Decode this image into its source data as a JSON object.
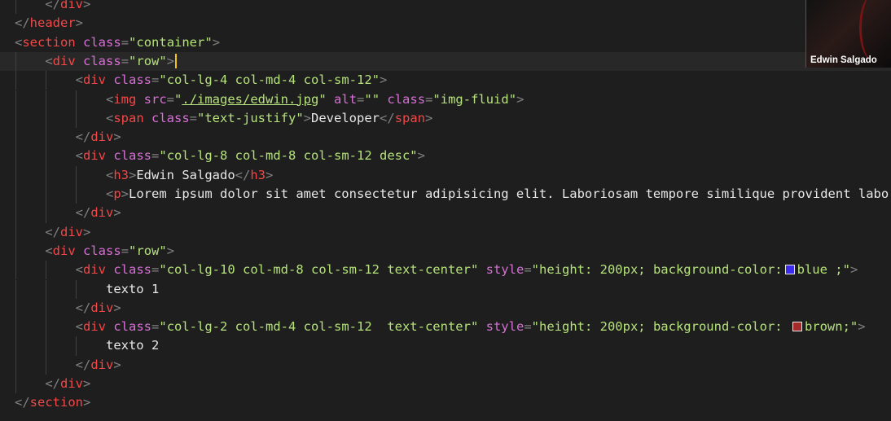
{
  "editor": {
    "lines": [
      [
        {
          "c": "t-p",
          "t": "    </"
        },
        {
          "c": "t-tag",
          "t": "div"
        },
        {
          "c": "t-p",
          "t": ">"
        }
      ],
      [
        {
          "c": "t-p",
          "t": "</"
        },
        {
          "c": "t-tag",
          "t": "header"
        },
        {
          "c": "t-p",
          "t": ">"
        }
      ],
      [
        {
          "c": "t-p",
          "t": "<"
        },
        {
          "c": "t-tag",
          "t": "section"
        },
        {
          "c": "t-p",
          "t": " "
        },
        {
          "c": "t-attr",
          "t": "class"
        },
        {
          "c": "t-p",
          "t": "="
        },
        {
          "c": "t-str",
          "t": "\"container\""
        },
        {
          "c": "t-p",
          "t": ">"
        }
      ],
      [
        {
          "c": "t-p",
          "t": "    <"
        },
        {
          "c": "t-tag",
          "t": "div"
        },
        {
          "c": "t-p",
          "t": " "
        },
        {
          "c": "t-attr",
          "t": "class"
        },
        {
          "c": "t-p",
          "t": "="
        },
        {
          "c": "t-str",
          "t": "\"row\""
        },
        {
          "c": "t-p",
          "t": ">"
        },
        {
          "c": "cursor",
          "t": ""
        }
      ],
      [
        {
          "c": "t-p",
          "t": "        <"
        },
        {
          "c": "t-tag",
          "t": "div"
        },
        {
          "c": "t-p",
          "t": " "
        },
        {
          "c": "t-attr",
          "t": "class"
        },
        {
          "c": "t-p",
          "t": "="
        },
        {
          "c": "t-str",
          "t": "\"col-lg-4 col-md-4 col-sm-12\""
        },
        {
          "c": "t-p",
          "t": ">"
        }
      ],
      [
        {
          "c": "t-p",
          "t": "            <"
        },
        {
          "c": "t-tag",
          "t": "img"
        },
        {
          "c": "t-p",
          "t": " "
        },
        {
          "c": "t-attr",
          "t": "src"
        },
        {
          "c": "t-p",
          "t": "="
        },
        {
          "c": "t-str",
          "t": "\""
        },
        {
          "c": "t-str t-link",
          "t": "./images/edwin.jpg"
        },
        {
          "c": "t-str",
          "t": "\""
        },
        {
          "c": "t-p",
          "t": " "
        },
        {
          "c": "t-attr",
          "t": "alt"
        },
        {
          "c": "t-p",
          "t": "="
        },
        {
          "c": "t-str",
          "t": "\"\""
        },
        {
          "c": "t-p",
          "t": " "
        },
        {
          "c": "t-attr",
          "t": "class"
        },
        {
          "c": "t-p",
          "t": "="
        },
        {
          "c": "t-str",
          "t": "\"img-fluid\""
        },
        {
          "c": "t-p",
          "t": ">"
        }
      ],
      [
        {
          "c": "t-p",
          "t": "            <"
        },
        {
          "c": "t-tag",
          "t": "span"
        },
        {
          "c": "t-p",
          "t": " "
        },
        {
          "c": "t-attr",
          "t": "class"
        },
        {
          "c": "t-p",
          "t": "="
        },
        {
          "c": "t-str",
          "t": "\"text-justify\""
        },
        {
          "c": "t-p",
          "t": ">"
        },
        {
          "c": "t-text",
          "t": "Developer"
        },
        {
          "c": "t-p",
          "t": "</"
        },
        {
          "c": "t-tag",
          "t": "span"
        },
        {
          "c": "t-p",
          "t": ">"
        }
      ],
      [
        {
          "c": "t-p",
          "t": "        </"
        },
        {
          "c": "t-tag",
          "t": "div"
        },
        {
          "c": "t-p",
          "t": ">"
        }
      ],
      [
        {
          "c": "t-p",
          "t": "        <"
        },
        {
          "c": "t-tag",
          "t": "div"
        },
        {
          "c": "t-p",
          "t": " "
        },
        {
          "c": "t-attr",
          "t": "class"
        },
        {
          "c": "t-p",
          "t": "="
        },
        {
          "c": "t-str",
          "t": "\"col-lg-8 col-md-8 col-sm-12 desc\""
        },
        {
          "c": "t-p",
          "t": ">"
        }
      ],
      [
        {
          "c": "t-p",
          "t": "            <"
        },
        {
          "c": "t-tag",
          "t": "h3"
        },
        {
          "c": "t-p",
          "t": ">"
        },
        {
          "c": "t-text",
          "t": "Edwin Salgado"
        },
        {
          "c": "t-p",
          "t": "</"
        },
        {
          "c": "t-tag",
          "t": "h3"
        },
        {
          "c": "t-p",
          "t": ">"
        }
      ],
      [
        {
          "c": "t-p",
          "t": "            <"
        },
        {
          "c": "t-tag",
          "t": "p"
        },
        {
          "c": "t-p",
          "t": ">"
        },
        {
          "c": "t-text",
          "t": "Lorem ipsum dolor sit amet consectetur adipisicing elit. Laboriosam tempore similique provident labo"
        }
      ],
      [
        {
          "c": "t-p",
          "t": "        </"
        },
        {
          "c": "t-tag",
          "t": "div"
        },
        {
          "c": "t-p",
          "t": ">"
        }
      ],
      [
        {
          "c": "t-p",
          "t": "    </"
        },
        {
          "c": "t-tag",
          "t": "div"
        },
        {
          "c": "t-p",
          "t": ">"
        }
      ],
      [
        {
          "c": "t-p",
          "t": "    <"
        },
        {
          "c": "t-tag",
          "t": "div"
        },
        {
          "c": "t-p",
          "t": " "
        },
        {
          "c": "t-attr",
          "t": "class"
        },
        {
          "c": "t-p",
          "t": "="
        },
        {
          "c": "t-str",
          "t": "\"row\""
        },
        {
          "c": "t-p",
          "t": ">"
        }
      ],
      [
        {
          "c": "t-p",
          "t": "        <"
        },
        {
          "c": "t-tag",
          "t": "div"
        },
        {
          "c": "t-p",
          "t": " "
        },
        {
          "c": "t-attr",
          "t": "class"
        },
        {
          "c": "t-p",
          "t": "="
        },
        {
          "c": "t-str",
          "t": "\"col-lg-10 col-md-8 col-sm-12 text-center\""
        },
        {
          "c": "t-p",
          "t": " "
        },
        {
          "c": "t-attr",
          "t": "style"
        },
        {
          "c": "t-p",
          "t": "="
        },
        {
          "c": "t-str",
          "t": "\"height: 200px; background-color:"
        },
        {
          "c": "swatch",
          "t": "#3b2cf0"
        },
        {
          "c": "t-str",
          "t": "blue ;\""
        },
        {
          "c": "t-p",
          "t": ">"
        }
      ],
      [
        {
          "c": "t-text",
          "t": "            texto 1"
        }
      ],
      [
        {
          "c": "t-p",
          "t": "        </"
        },
        {
          "c": "t-tag",
          "t": "div"
        },
        {
          "c": "t-p",
          "t": ">"
        }
      ],
      [
        {
          "c": "t-p",
          "t": "        <"
        },
        {
          "c": "t-tag",
          "t": "div"
        },
        {
          "c": "t-p",
          "t": " "
        },
        {
          "c": "t-attr",
          "t": "class"
        },
        {
          "c": "t-p",
          "t": "="
        },
        {
          "c": "t-str",
          "t": "\"col-lg-2 col-md-4 col-sm-12  text-center\""
        },
        {
          "c": "t-p",
          "t": " "
        },
        {
          "c": "t-attr",
          "t": "style"
        },
        {
          "c": "t-p",
          "t": "="
        },
        {
          "c": "t-str",
          "t": "\"height: 200px; background-color: "
        },
        {
          "c": "swatch",
          "t": "#a52a2a"
        },
        {
          "c": "t-str",
          "t": "brown;\""
        },
        {
          "c": "t-p",
          "t": ">"
        }
      ],
      [
        {
          "c": "t-text",
          "t": "            texto 2"
        }
      ],
      [
        {
          "c": "t-p",
          "t": "        </"
        },
        {
          "c": "t-tag",
          "t": "div"
        },
        {
          "c": "t-p",
          "t": ">"
        }
      ],
      [
        {
          "c": "t-p",
          "t": "    </"
        },
        {
          "c": "t-tag",
          "t": "div"
        },
        {
          "c": "t-p",
          "t": ">"
        }
      ],
      [
        {
          "c": "t-p",
          "t": "</"
        },
        {
          "c": "t-tag",
          "t": "section"
        },
        {
          "c": "t-p",
          "t": ">"
        }
      ]
    ],
    "current_line_index": 3,
    "colors": {
      "background": "#1e1e1e",
      "tag": "#f44747",
      "attribute": "#d76fd6",
      "string": "#b5e27a",
      "punctuation": "#808080",
      "text": "#e8e8e8",
      "cursor": "#f0c419"
    }
  },
  "video_call": {
    "participant_name": "Edwin Salgado"
  }
}
